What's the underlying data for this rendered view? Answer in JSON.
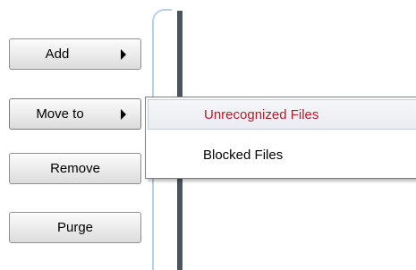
{
  "buttons": {
    "add": "Add",
    "move_to": "Move to",
    "remove": "Remove",
    "purge": "Purge"
  },
  "submenu": {
    "items": [
      "Unrecognized Files",
      "Blocked Files"
    ],
    "highlighted_index": 0,
    "highlight_text_color": "#b01e2e"
  },
  "icons": {
    "submenu_arrow": "triangle-right-icon"
  }
}
